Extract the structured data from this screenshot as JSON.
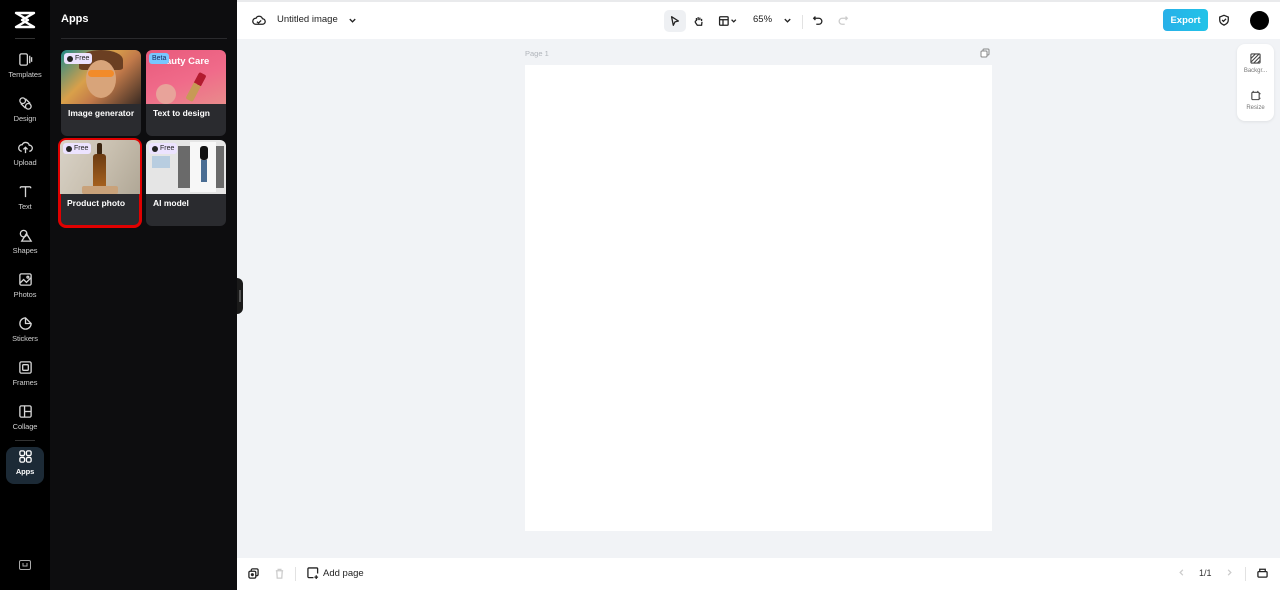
{
  "rail": {
    "items": [
      {
        "label": "Templates",
        "icon": "templates-icon"
      },
      {
        "label": "Design",
        "icon": "design-icon"
      },
      {
        "label": "Upload",
        "icon": "upload-icon"
      },
      {
        "label": "Text",
        "icon": "text-icon"
      },
      {
        "label": "Shapes",
        "icon": "shapes-icon"
      },
      {
        "label": "Photos",
        "icon": "photos-icon"
      },
      {
        "label": "Stickers",
        "icon": "stickers-icon"
      },
      {
        "label": "Frames",
        "icon": "frames-icon"
      },
      {
        "label": "Collage",
        "icon": "collage-icon"
      },
      {
        "label": "Apps",
        "icon": "apps-icon",
        "active": true
      }
    ]
  },
  "panel": {
    "title": "Apps",
    "cards": [
      {
        "label": "Image generator",
        "badge": "Free"
      },
      {
        "label": "Text to design",
        "badge": "Beta",
        "thumb_text": "auty Care"
      },
      {
        "label": "Product photo",
        "badge": "Free",
        "selected": true
      },
      {
        "label": "AI model",
        "badge": "Free"
      }
    ]
  },
  "topbar": {
    "doc_title": "Untitled image",
    "zoom": "65%",
    "export_label": "Export"
  },
  "canvas": {
    "page_label": "Page 1"
  },
  "right_panel": {
    "background_label": "Backgr...",
    "resize_label": "Resize"
  },
  "bottombar": {
    "add_page_label": "Add page",
    "pager": "1/1"
  },
  "colors": {
    "export_accent": "#28b0e8",
    "selected_outline": "#e00000",
    "rail_bg": "#000000",
    "panel_bg": "#0d0d0f",
    "canvas_bg": "#f1f3f6"
  }
}
